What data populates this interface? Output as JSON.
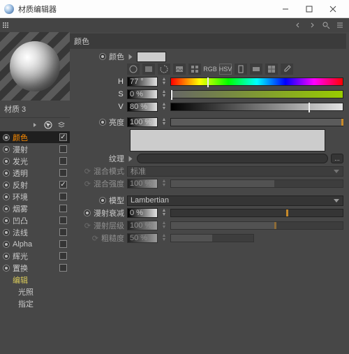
{
  "title": "材质编辑器",
  "material_name": "材质 3",
  "channels": [
    {
      "label": "颜色",
      "radio": true,
      "check": true,
      "selected": true
    },
    {
      "label": "漫射",
      "radio": true,
      "check": false
    },
    {
      "label": "发光",
      "radio": true,
      "check": false
    },
    {
      "label": "透明",
      "radio": true,
      "check": false
    },
    {
      "label": "反射",
      "radio": true,
      "check": true
    },
    {
      "label": "环境",
      "radio": true,
      "check": false
    },
    {
      "label": "烟雾",
      "radio": true,
      "check": false
    },
    {
      "label": "凹凸",
      "radio": true,
      "check": false
    },
    {
      "label": "法线",
      "radio": true,
      "check": false
    },
    {
      "label": "Alpha",
      "radio": true,
      "check": false
    },
    {
      "label": "辉光",
      "radio": true,
      "check": false
    },
    {
      "label": "置换",
      "radio": true,
      "check": false
    }
  ],
  "channels_bottom": [
    {
      "label": "编辑"
    },
    {
      "label": "光照"
    },
    {
      "label": "指定"
    }
  ],
  "panel": {
    "section_color": "颜色",
    "label_color": "颜色",
    "hsv": {
      "h": "77 °",
      "s": "0 %",
      "v": "80 %"
    },
    "brightness_label": "亮度",
    "brightness_value": "100 %",
    "texture_label": "纹理",
    "texture_button": "...",
    "blend_mode_label": "混合模式",
    "blend_mode_value": "标准",
    "blend_strength_label": "混合强度",
    "blend_strength_value": "100 %",
    "model_label": "模型",
    "model_value": "Lambertian",
    "diffuse_falloff_label": "漫射衰减",
    "diffuse_falloff_value": "0 %",
    "diffuse_level_label": "漫射层级",
    "diffuse_level_value": "100 %",
    "roughness_label": "粗糙度",
    "roughness_value": "50 %"
  },
  "colors": {
    "swatch": "#cdcdcd"
  }
}
